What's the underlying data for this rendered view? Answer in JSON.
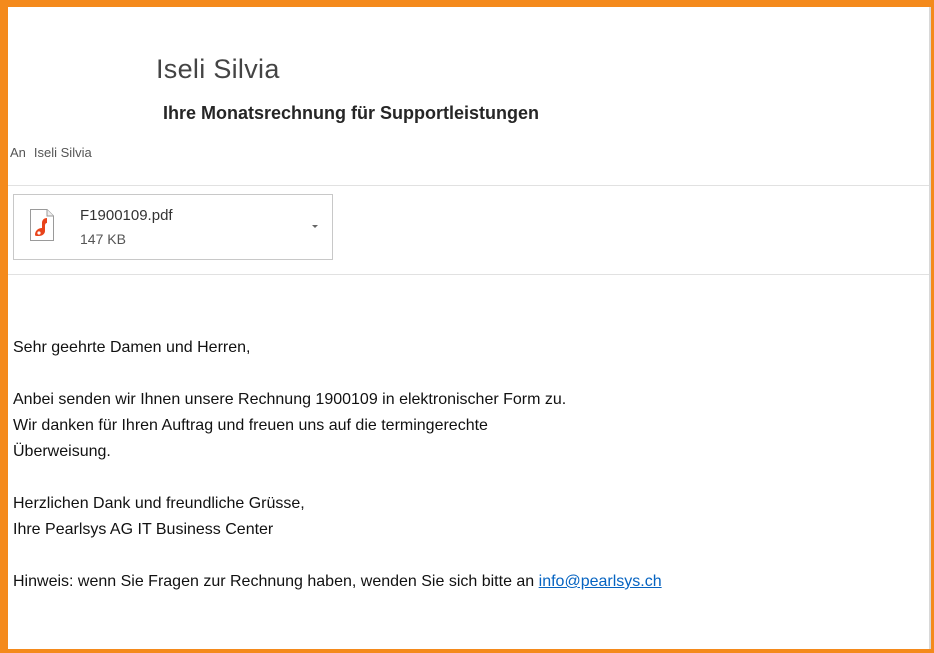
{
  "message": {
    "sender_name": "Iseli Silvia",
    "subject": "Ihre Monatsrechnung für Supportleistungen",
    "to_label": "An",
    "to_name": "Iseli Silvia"
  },
  "attachment": {
    "file_name": "F1900109.pdf",
    "file_size": "147 KB",
    "icon": "pdf-icon"
  },
  "body": {
    "greeting": "Sehr geehrte Damen und Herren,",
    "line1": "Anbei senden wir Ihnen unsere Rechnung 1900109  in elektronischer Form zu.",
    "line2": "Wir danken für Ihren Auftrag und freuen uns auf die termingerechte",
    "line3": "Überweisung.",
    "closing1": "Herzlichen Dank und freundliche Grüsse,",
    "closing2": "Ihre Pearlsys AG IT Business Center",
    "note_prefix": "Hinweis: wenn Sie Fragen zur Rechnung haben, wenden Sie sich bitte an ",
    "note_email": "info@pearlsys.ch"
  },
  "colors": {
    "highlight_border": "#f48a1c",
    "link": "#0563c1",
    "pdf_icon": "#e8431a"
  }
}
